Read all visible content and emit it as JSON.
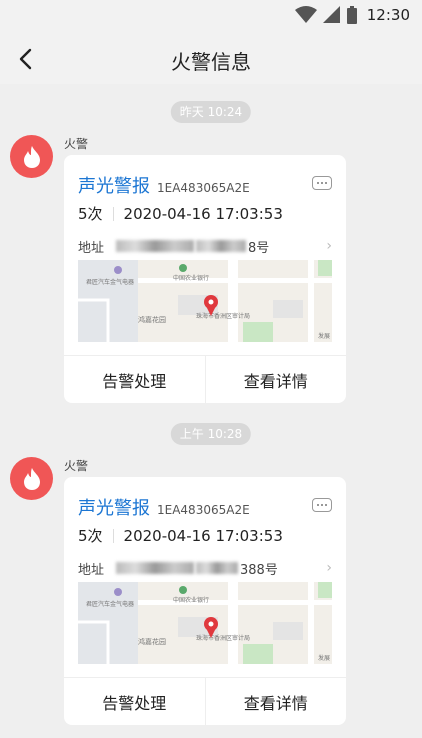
{
  "status": {
    "time": "12:30"
  },
  "nav": {
    "title": "火警信息"
  },
  "messages": [
    {
      "time": "昨天 10:24",
      "sender": "火警",
      "card": {
        "alarm_type": "声光警报",
        "device_id": "1EA483065A2E",
        "count": "5次",
        "datetime": "2020-04-16 17:03:53",
        "address_label": "地址",
        "address_suffix": "8号",
        "map_labels": [
          "君匠汽车金气电器",
          "中国农业银行",
          "鸿嘉花园",
          "珠海市香洲区审计局",
          "发展"
        ],
        "action_handle": "告警处理",
        "action_detail": "查看详情"
      }
    },
    {
      "time": "上午 10:28",
      "sender": "火警",
      "card": {
        "alarm_type": "声光警报",
        "device_id": "1EA483065A2E",
        "count": "5次",
        "datetime": "2020-04-16 17:03:53",
        "address_label": "地址",
        "address_suffix": "388号",
        "map_labels": [
          "君匠汽车金气电器",
          "中国农业银行",
          "鸿嘉花园",
          "珠海市香洲区审计局",
          "发展"
        ],
        "action_handle": "告警处理",
        "action_detail": "查看详情"
      }
    }
  ],
  "colors": {
    "accent": "#1c76d3",
    "fire": "#f05656",
    "pin": "#e0393e"
  },
  "icons": [
    "wifi-icon",
    "signal-icon",
    "battery-icon",
    "back-arrow-icon",
    "flame-icon",
    "more-icon",
    "chevron-right-icon",
    "map-pin-icon"
  ]
}
